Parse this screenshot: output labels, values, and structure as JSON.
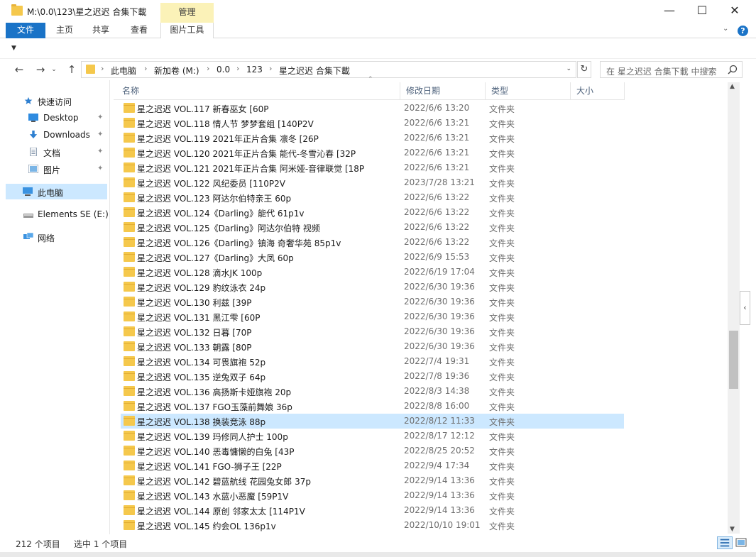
{
  "window": {
    "title": "M:\\0.0\\123\\星之迟迟 合集下載",
    "context_tab": "管理",
    "minimize": "—",
    "maximize": "☐",
    "close": "✕"
  },
  "ribbon": {
    "tabs": [
      "文件",
      "主页",
      "共享",
      "查看",
      "图片工具"
    ],
    "collapse": "⌄",
    "help": "?"
  },
  "navigation": {
    "back": "←",
    "forward": "→",
    "recent": "⌄",
    "up": "↑",
    "breadcrumbs": [
      "此电脑",
      "新加卷 (M:)",
      "0.0",
      "123",
      "星之迟迟 合集下載"
    ],
    "separator": "›",
    "refresh": "↻",
    "search_placeholder": "在 星之迟迟 合集下載 中搜索"
  },
  "nav_pane": {
    "quick_access": "快速访问",
    "items": [
      {
        "label": "Desktop",
        "icon": "desktop-icon",
        "pinned": true
      },
      {
        "label": "Downloads",
        "icon": "download-icon",
        "pinned": true
      },
      {
        "label": "文档",
        "icon": "document-icon",
        "pinned": true
      },
      {
        "label": "图片",
        "icon": "picture-icon",
        "pinned": true
      }
    ],
    "this_pc": "此电脑",
    "drive": "Elements SE (E:)",
    "network": "网络",
    "pin_glyph": "📌"
  },
  "columns": {
    "name": "名称",
    "date": "修改日期",
    "type": "类型",
    "size": "大小"
  },
  "files": [
    {
      "name": "星之迟迟 VOL.117 新春巫女 [60P",
      "date": "2022/6/6 13:20",
      "type": "文件夹"
    },
    {
      "name": "星之迟迟 VOL.118 情人节 梦梦套组 [140P2V",
      "date": "2022/6/6 13:21",
      "type": "文件夹"
    },
    {
      "name": "星之迟迟 VOL.119 2021年正片合集 凛冬 [26P",
      "date": "2022/6/6 13:21",
      "type": "文件夹"
    },
    {
      "name": "星之迟迟 VOL.120 2021年正片合集 能代-冬雪沁春 [32P",
      "date": "2022/6/6 13:21",
      "type": "文件夹"
    },
    {
      "name": "星之迟迟 VOL.121 2021年正片合集 阿米娅-音律联觉 [18P",
      "date": "2022/6/6 13:21",
      "type": "文件夹"
    },
    {
      "name": "星之迟迟 VOL.122 风纪委员 [110P2V",
      "date": "2023/7/28 13:21",
      "type": "文件夹"
    },
    {
      "name": "星之迟迟 VOL.123 阿达尔伯特亲王 60p",
      "date": "2022/6/6 13:22",
      "type": "文件夹"
    },
    {
      "name": "星之迟迟 VOL.124《Darling》能代 61p1v",
      "date": "2022/6/6 13:22",
      "type": "文件夹"
    },
    {
      "name": "星之迟迟 VOL.125《Darling》阿达尔伯特 视频",
      "date": "2022/6/6 13:22",
      "type": "文件夹"
    },
    {
      "name": "星之迟迟 VOL.126《Darling》镇海 奇奢华苑 85p1v",
      "date": "2022/6/6 13:22",
      "type": "文件夹"
    },
    {
      "name": "星之迟迟 VOL.127《Darling》大凤 60p",
      "date": "2022/6/9 15:53",
      "type": "文件夹"
    },
    {
      "name": "星之迟迟 VOL.128 滴水JK 100p",
      "date": "2022/6/19 17:04",
      "type": "文件夹"
    },
    {
      "name": "星之迟迟 VOL.129 豹纹泳衣 24p",
      "date": "2022/6/30 19:36",
      "type": "文件夹"
    },
    {
      "name": "星之迟迟 VOL.130 利兹 [39P",
      "date": "2022/6/30 19:36",
      "type": "文件夹"
    },
    {
      "name": "星之迟迟 VOL.131 黑江雫 [60P",
      "date": "2022/6/30 19:36",
      "type": "文件夹"
    },
    {
      "name": "星之迟迟 VOL.132 日暮 [70P",
      "date": "2022/6/30 19:36",
      "type": "文件夹"
    },
    {
      "name": "星之迟迟 VOL.133 朝露 [80P",
      "date": "2022/6/30 19:36",
      "type": "文件夹"
    },
    {
      "name": "星之迟迟 VOL.134 可畏旗袍 52p",
      "date": "2022/7/4 19:31",
      "type": "文件夹"
    },
    {
      "name": "星之迟迟 VOL.135 逆兔双子 64p",
      "date": "2022/7/8 19:36",
      "type": "文件夹"
    },
    {
      "name": "星之迟迟 VOL.136 高扬斯卡娅旗袍 20p",
      "date": "2022/8/3 14:38",
      "type": "文件夹"
    },
    {
      "name": "星之迟迟 VOL.137 FGO玉藻前舞娘 36p",
      "date": "2022/8/8 16:00",
      "type": "文件夹"
    },
    {
      "name": "星之迟迟 VOL.138 换装竞泳 88p",
      "date": "2022/8/12 11:33",
      "type": "文件夹",
      "selected": true
    },
    {
      "name": "星之迟迟 VOL.139 玛修同人护士 100p",
      "date": "2022/8/17 12:12",
      "type": "文件夹"
    },
    {
      "name": "星之迟迟 VOL.140 恶毒慵懒的白兔 [43P",
      "date": "2022/8/25 20:52",
      "type": "文件夹"
    },
    {
      "name": "星之迟迟 VOL.141 FGO-狮子王 [22P",
      "date": "2022/9/4 17:34",
      "type": "文件夹"
    },
    {
      "name": "星之迟迟 VOL.142 碧蓝航线 花园兔女郎 37p",
      "date": "2022/9/14 13:36",
      "type": "文件夹"
    },
    {
      "name": "星之迟迟 VOL.143 水蓝小恶魔 [59P1V",
      "date": "2022/9/14 13:36",
      "type": "文件夹"
    },
    {
      "name": "星之迟迟 VOL.144 原创 邻家太太 [114P1V",
      "date": "2022/9/14 13:36",
      "type": "文件夹"
    },
    {
      "name": "星之迟迟 VOL.145 约会OL 136p1v",
      "date": "2022/10/10 19:01",
      "type": "文件夹"
    }
  ],
  "status": {
    "count": "212 个项目",
    "selection": "选中 1 个项目"
  },
  "colors": {
    "accent": "#1a73c7",
    "selection": "#cce8ff",
    "folder": "#f5c84c",
    "context_tab": "#fbf2b8"
  }
}
